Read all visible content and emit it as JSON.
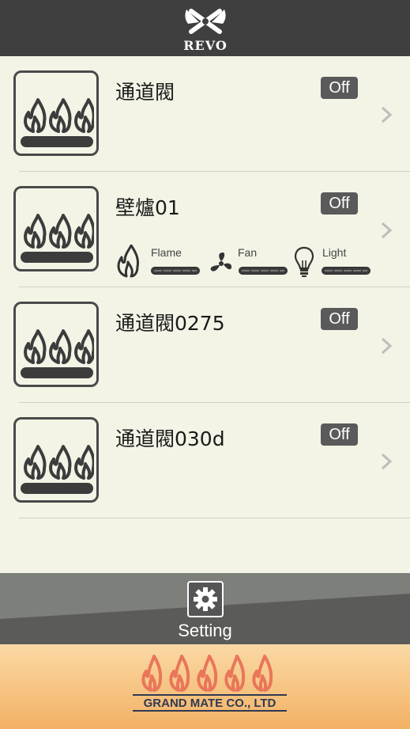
{
  "header": {
    "logo_text": "REVO"
  },
  "devices": [
    {
      "name": "通道閥",
      "status": "Off"
    },
    {
      "name": "壁爐01",
      "status": "Off",
      "controls": {
        "flame_label": "Flame",
        "fan_label": "Fan",
        "light_label": "Light"
      }
    },
    {
      "name": "通道閥0275",
      "status": "Off"
    },
    {
      "name": "通道閥030d",
      "status": "Off"
    }
  ],
  "bottom_bar": {
    "setting_label": "Setting"
  },
  "footer": {
    "company": "GRAND MATE CO., LTD"
  },
  "colors": {
    "topbar": "#3f3f3f",
    "list_bg": "#f3f4e6",
    "bottom_bar": "#5b5b59",
    "footer_orange": "#f2b165",
    "flame_orange": "#e9765a"
  }
}
